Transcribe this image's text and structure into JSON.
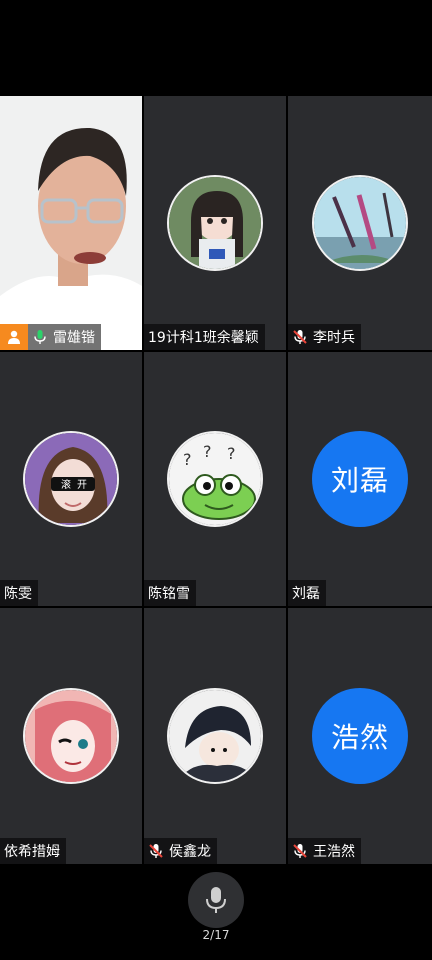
{
  "participants": [
    {
      "name": "雷雄锴",
      "type": "video",
      "mic": "on",
      "is_host": true
    },
    {
      "name": "19计科1班余馨颖",
      "type": "image",
      "mic": "none"
    },
    {
      "name": "李时兵",
      "type": "image",
      "mic": "muted"
    },
    {
      "name": "陈雯",
      "type": "image",
      "mic": "none"
    },
    {
      "name": "陈铭雪",
      "type": "image",
      "mic": "none"
    },
    {
      "name": "刘磊",
      "type": "text",
      "initials": "刘磊",
      "mic": "none"
    },
    {
      "name": "依希措姆",
      "type": "image",
      "mic": "none"
    },
    {
      "name": "侯鑫龙",
      "type": "image",
      "mic": "muted"
    },
    {
      "name": "王浩然",
      "type": "text",
      "initials": "浩然",
      "mic": "muted"
    }
  ],
  "avatar_labels": {
    "p4_glasses_left": "滚",
    "p4_glasses_right": "开"
  },
  "colors": {
    "accent_blue": "#1677f2",
    "active_border": "#21c26b",
    "host_badge": "#f68a1f",
    "muted_red": "#e8463b"
  },
  "bottom_bar": {
    "mic_icon": "microphone-icon",
    "page_indicator": "2/17"
  }
}
